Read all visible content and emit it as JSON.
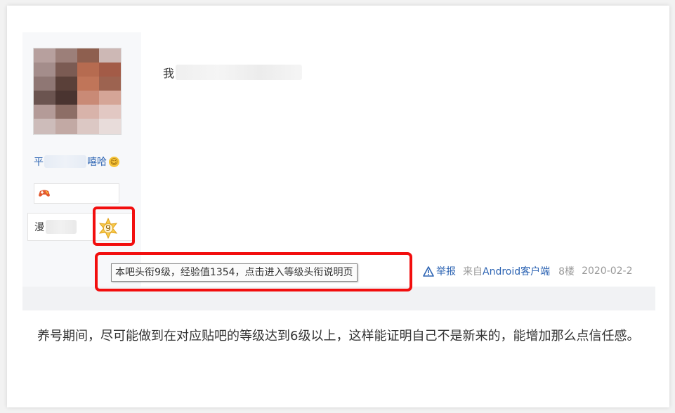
{
  "post": {
    "text_prefix": "我",
    "username_prefix": "平",
    "username_suffix": "嘻哈",
    "level_name_prefix": "漫",
    "level_number": "9"
  },
  "tooltip": {
    "text": "本吧头衔9级，经验值1354，点击进入等级头衔说明页"
  },
  "meta": {
    "report_label": "举报",
    "from_prefix": "来自",
    "from_client": "Android客户端",
    "floor": "8楼",
    "date": "2020-02-2"
  },
  "article": {
    "paragraph": "养号期间，尽可能做到在对应贴吧的等级达到6级以上，这样能证明自己不是新来的，能增加那么点信任感。"
  },
  "colors": {
    "highlight": "#f20e0e",
    "link": "#2d64b3"
  }
}
